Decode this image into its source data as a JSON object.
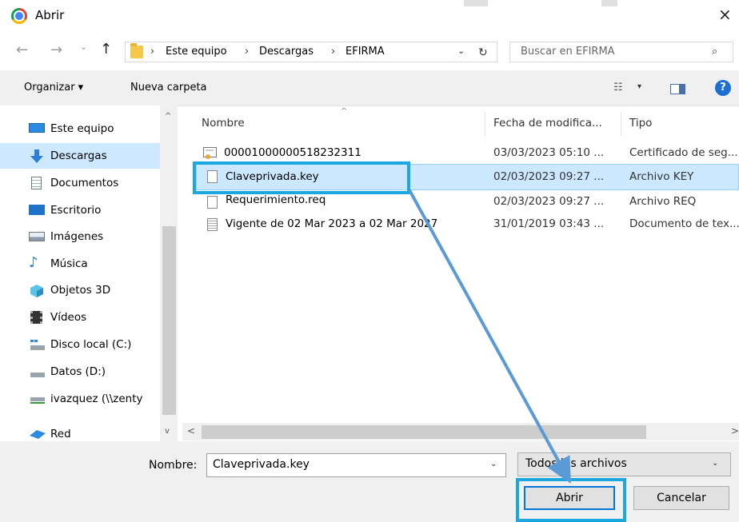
{
  "window": {
    "title": "Abrir",
    "close_glyph": "×"
  },
  "address": {
    "crumbs": [
      "Este equipo",
      "Descargas",
      "EFIRMA"
    ],
    "separator": "›",
    "dropdown_glyph": "⌄",
    "refresh_glyph": "↻",
    "search_placeholder": "Buscar en EFIRMA",
    "back_glyph": "←",
    "forward_glyph": "→",
    "recent_glyph": "⌄",
    "up_glyph": "↑"
  },
  "toolbar": {
    "organizar_label": "Organizar ▾",
    "nueva_label": "Nueva carpeta",
    "view_glyph": "☷",
    "view_dd_glyph": "▾",
    "help_glyph": "?"
  },
  "nav": {
    "items": [
      {
        "label": "Este equipo",
        "icon": "computer-icon"
      },
      {
        "label": "Descargas",
        "icon": "download-icon"
      },
      {
        "label": "Documentos",
        "icon": "document-icon"
      },
      {
        "label": "Escritorio",
        "icon": "desktop-icon"
      },
      {
        "label": "Imágenes",
        "icon": "image-icon"
      },
      {
        "label": "Música",
        "icon": "music-icon"
      },
      {
        "label": "Objetos 3D",
        "icon": "cube-icon"
      },
      {
        "label": "Vídeos",
        "icon": "video-icon"
      },
      {
        "label": "Disco local (C:)",
        "icon": "drive-icon"
      },
      {
        "label": "Datos (D:)",
        "icon": "drive-icon"
      },
      {
        "label": "ivazquez (\\\\zenty",
        "icon": "network-drive-icon"
      },
      {
        "label": "Red",
        "icon": "network-icon"
      }
    ],
    "selected_index": 1,
    "scroll_up_glyph": "^",
    "scroll_down_glyph": "v"
  },
  "files": {
    "columns": [
      "Nombre",
      "Fecha de modifica...",
      "Tipo"
    ],
    "rows": [
      {
        "name": "00001000000518232311",
        "date": "03/03/2023 05:10 ...",
        "type": "Certificado de seg...",
        "icon": "certificate-icon"
      },
      {
        "name": "Claveprivada.key",
        "date": "02/03/2023 09:27 ...",
        "type": "Archivo KEY",
        "icon": "file-icon"
      },
      {
        "name": "Requerimiento.req",
        "date": "02/03/2023 09:27 ...",
        "type": "Archivo REQ",
        "icon": "file-icon"
      },
      {
        "name": "Vigente de 02 Mar 2023 a 02 Mar 2027",
        "date": "31/01/2019 03:43 ...",
        "type": "Documento de tex...",
        "icon": "text-file-icon"
      }
    ],
    "selected_index": 1,
    "sort_glyph": "^",
    "hscroll_left_glyph": "<",
    "hscroll_right_glyph": ">"
  },
  "bottom": {
    "nombre_label": "Nombre:",
    "nombre_value": "Claveprivada.key",
    "filter_value": "Todos los archivos",
    "dd_glyph": "⌄",
    "abrir_label": "Abrir",
    "cancelar_label": "Cancelar"
  },
  "annotation": {
    "highlight_color": "#1ba7e0",
    "arrow_color": "#5b9bd5"
  }
}
